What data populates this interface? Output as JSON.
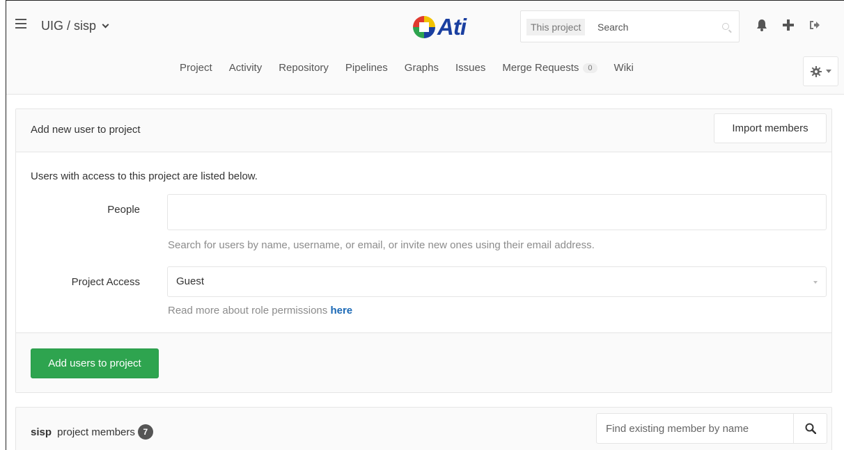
{
  "header": {
    "project_path": "UIG / sisp",
    "logo_text": "Ati",
    "search": {
      "scope": "This project",
      "placeholder": "Search"
    }
  },
  "nav": {
    "tabs": [
      {
        "label": "Project"
      },
      {
        "label": "Activity"
      },
      {
        "label": "Repository"
      },
      {
        "label": "Pipelines"
      },
      {
        "label": "Graphs"
      },
      {
        "label": "Issues"
      },
      {
        "label": "Merge Requests",
        "badge": "0"
      },
      {
        "label": "Wiki"
      }
    ]
  },
  "add_panel": {
    "title": "Add new user to project",
    "import_label": "Import members",
    "intro": "Users with access to this project are listed below.",
    "people_label": "People",
    "people_help": "Search for users by name, username, or email, or invite new ones using their email address.",
    "access_label": "Project Access",
    "access_value": "Guest",
    "access_help_prefix": "Read more about role permissions ",
    "access_help_link": "here",
    "submit_label": "Add users to project"
  },
  "members": {
    "project_name": "sisp",
    "title_suffix": " project members",
    "count": "7",
    "find_placeholder": "Find existing member by name"
  },
  "colors": {
    "accent_green": "#2ea44f",
    "link_blue": "#1b69b6",
    "logo_blue": "#1a3fa0"
  }
}
